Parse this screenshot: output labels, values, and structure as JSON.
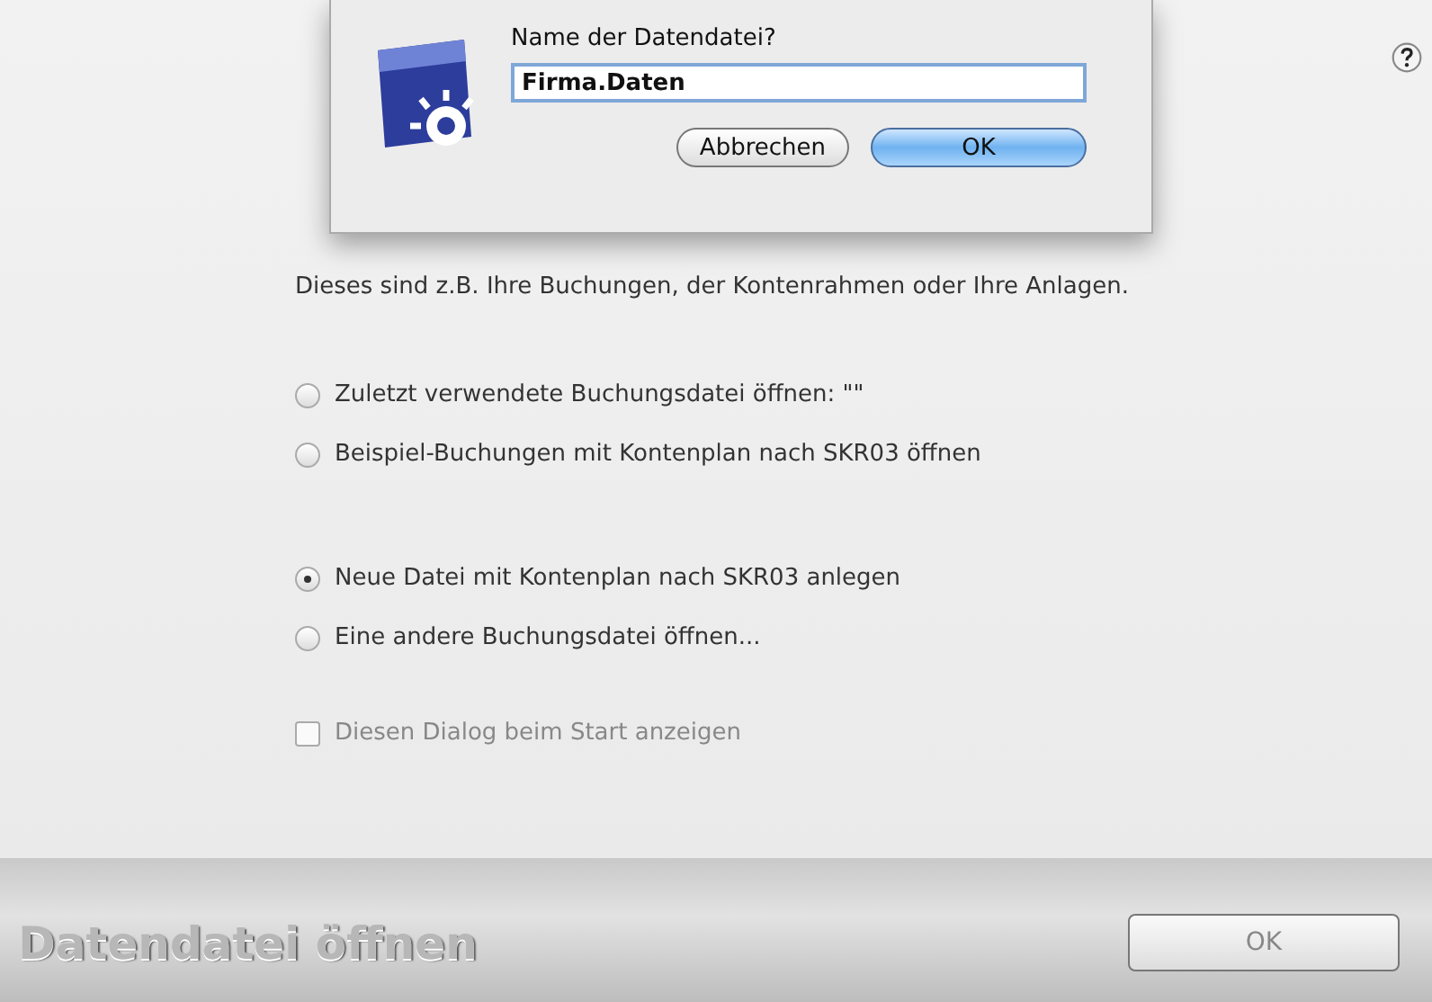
{
  "sheet": {
    "prompt": "Name der Datendatei?",
    "field": {
      "value": "Firma.Daten"
    },
    "buttons": [
      {
        "label": "Abbrechen",
        "default": false
      },
      {
        "label": "OK",
        "default": true
      }
    ]
  },
  "description": "Dieses sind z.B. Ihre Buchungen, der Kontenrahmen oder Ihre Anlagen.",
  "option_groups": [
    [
      {
        "label": "Zuletzt verwendete Buchungsdatei öffnen: \"\"",
        "selected": false
      },
      {
        "label": "Beispiel-Buchungen mit Kontenplan nach SKR03 öffnen",
        "selected": false
      }
    ],
    [
      {
        "label": "Neue Datei mit Kontenplan nach SKR03 anlegen",
        "selected": true
      },
      {
        "label": "Eine andere Buchungsdatei öffnen...",
        "selected": false
      }
    ]
  ],
  "show_at_start": {
    "label": "Diesen Dialog beim Start anzeigen",
    "checked": false
  },
  "footer": {
    "title": "Datendatei öffnen",
    "button": "OK"
  }
}
